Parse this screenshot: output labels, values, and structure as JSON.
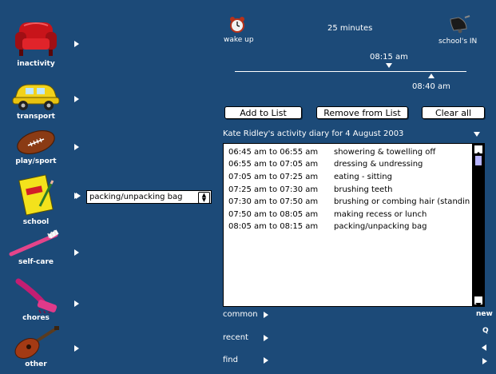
{
  "sidebar": {
    "categories": [
      {
        "label": "inactivity",
        "icon": "armchair-icon"
      },
      {
        "label": "transport",
        "icon": "car-icon"
      },
      {
        "label": "play/sport",
        "icon": "football-icon"
      },
      {
        "label": "school",
        "icon": "school-book-icon"
      },
      {
        "label": "self-care",
        "icon": "toothbrush-icon"
      },
      {
        "label": "chores",
        "icon": "scrub-brush-icon"
      },
      {
        "label": "other",
        "icon": "guitar-icon"
      }
    ]
  },
  "activity_select": {
    "value": "packing/unpacking bag"
  },
  "timeline": {
    "wake_label": "wake up",
    "duration": "25 minutes",
    "school_label": "school's IN",
    "start_time": "08:15 am",
    "end_time": "08:40 am"
  },
  "buttons": {
    "add": "Add to List",
    "remove": "Remove from List",
    "clear": "Clear all"
  },
  "diary": {
    "title": "Kate Ridley's activity diary for 4 August 2003",
    "entries": [
      {
        "time": "06:45 am to 06:55 am",
        "activity": "showering & towelling off"
      },
      {
        "time": "06:55 am to 07:05 am",
        "activity": "dressing & undressing"
      },
      {
        "time": "07:05 am to 07:25 am",
        "activity": "eating - sitting"
      },
      {
        "time": "07:25 am to 07:30 am",
        "activity": "brushing teeth"
      },
      {
        "time": "07:30 am to 07:50 am",
        "activity": "brushing or combing hair (standin"
      },
      {
        "time": "07:50 am to 08:05 am",
        "activity": "making recess or lunch"
      },
      {
        "time": "08:05 am to 08:15 am",
        "activity": "packing/unpacking bag"
      }
    ]
  },
  "bottom_nav": {
    "common": "common",
    "recent": "recent",
    "find": "find",
    "new": "new",
    "q": "Q"
  }
}
